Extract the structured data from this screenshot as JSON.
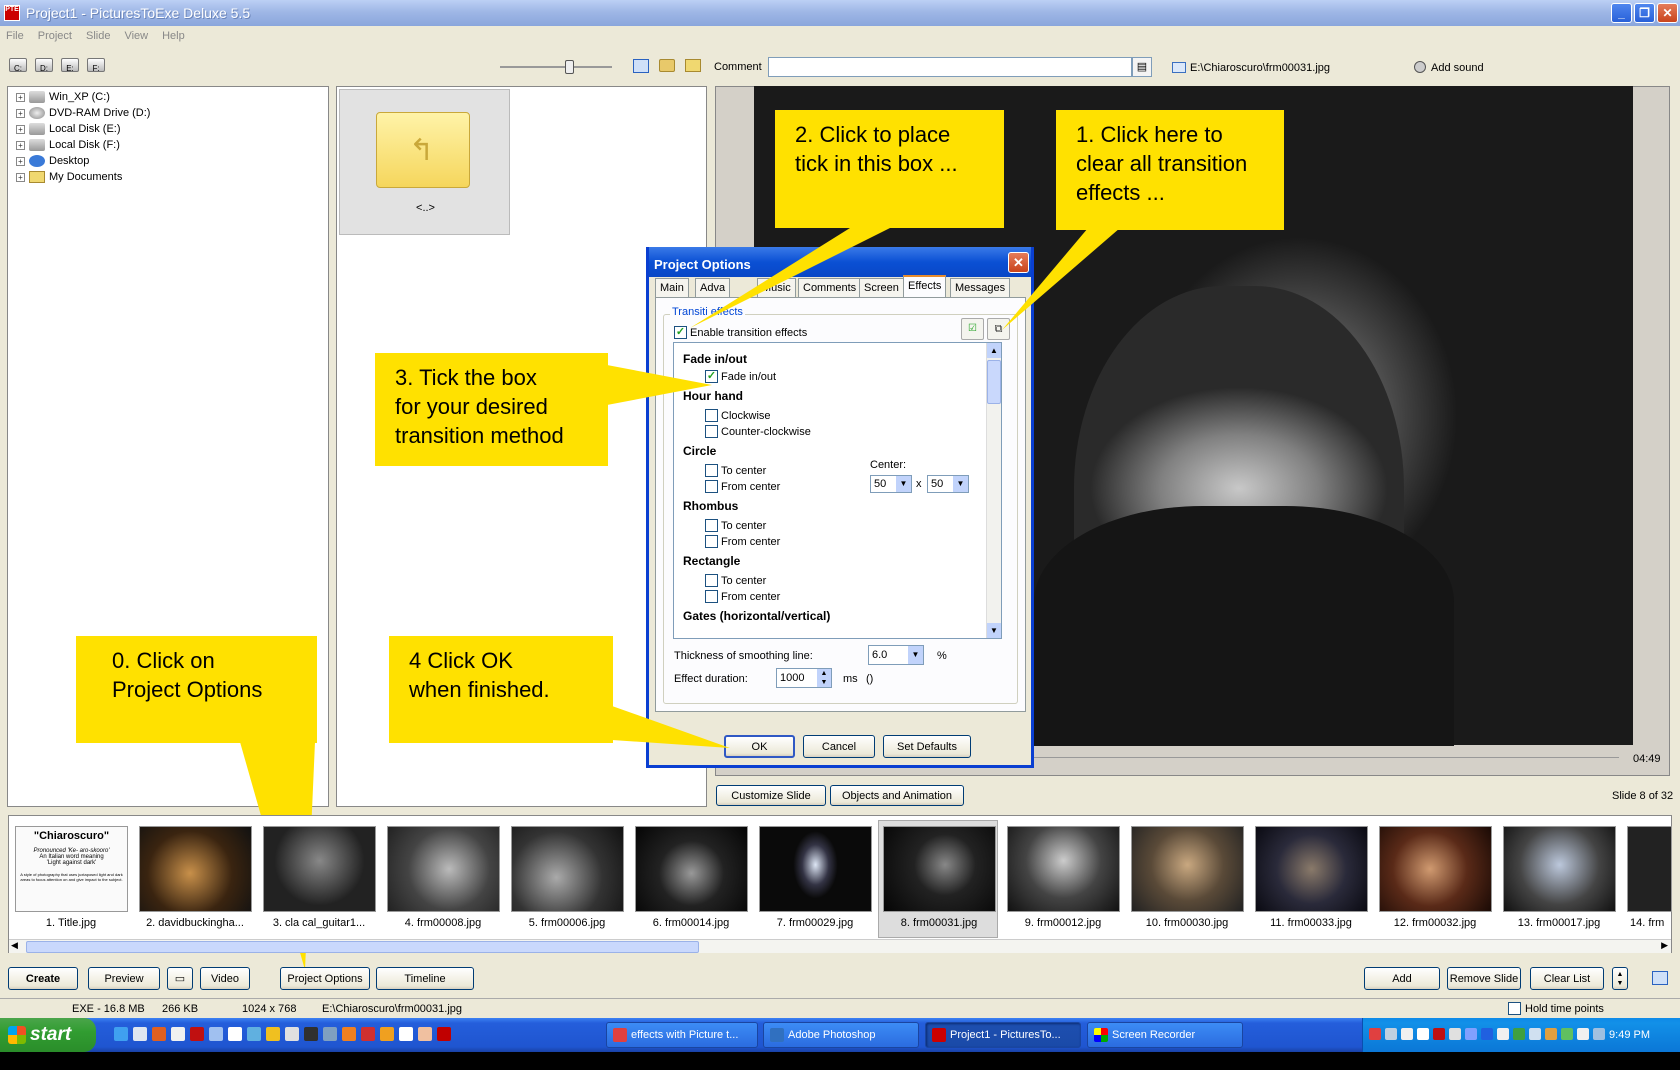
{
  "window": {
    "title": "Project1 - PicturesToExe Deluxe 5.5",
    "minimize": "_",
    "maximize": "❐",
    "close": "✕"
  },
  "menu": [
    "File",
    "Project",
    "Slide",
    "View",
    "Help"
  ],
  "drives_toolbar": [
    "C:",
    "D:",
    "E:",
    "F:"
  ],
  "comment": {
    "label": "Comment",
    "value": ""
  },
  "file_path": "E:\\Chiaroscuro\\frm00031.jpg",
  "add_sound": "Add sound",
  "tree": [
    {
      "label": "Win_XP (C:)"
    },
    {
      "label": "DVD-RAM Drive (D:)"
    },
    {
      "label": "Local Disk (E:)"
    },
    {
      "label": "Local Disk (F:)"
    },
    {
      "label": "Desktop"
    },
    {
      "label": "My Documents"
    }
  ],
  "folder_label": "<..>",
  "preview": {
    "time": "04:49",
    "slide_counter": "Slide 8 of 32"
  },
  "customize_slide": "Customize Slide",
  "objects_animation": "Objects and Animation",
  "dialog": {
    "title": "Project Options",
    "tabs": [
      "Main",
      "Adva",
      "Music",
      "Comments",
      "Screen",
      "Effects",
      "Messages"
    ],
    "active_tab": "Effects",
    "group_label": "Transiti  effects",
    "enable_label": "Enable transition effects",
    "groups": [
      {
        "name": "Fade in/out",
        "items": [
          {
            "label": "Fade in/out",
            "checked": true
          }
        ]
      },
      {
        "name": "Hour hand",
        "items": [
          {
            "label": "Clockwise",
            "checked": false
          },
          {
            "label": "Counter-clockwise",
            "checked": false
          }
        ]
      },
      {
        "name": "Circle",
        "items": [
          {
            "label": "To center",
            "checked": false
          },
          {
            "label": "From center",
            "checked": false
          }
        ]
      },
      {
        "name": "Rhombus",
        "items": [
          {
            "label": "To center",
            "checked": false
          },
          {
            "label": "From center",
            "checked": false
          }
        ]
      },
      {
        "name": "Rectangle",
        "items": [
          {
            "label": "To center",
            "checked": false
          },
          {
            "label": "From center",
            "checked": false
          }
        ]
      },
      {
        "name": "Gates (horizontal/vertical)",
        "items": []
      }
    ],
    "center_label": "Center:",
    "center_x": "50",
    "center_sep": "x",
    "center_y": "50",
    "thickness_label": "Thickness of smoothing line:",
    "thickness_value": "6.0",
    "thickness_unit": "%",
    "duration_label": "Effect duration:",
    "duration_value": "1000",
    "duration_unit": "ms",
    "duration_extra": "()",
    "ok": "OK",
    "cancel": "Cancel",
    "set_defaults": "Set Defaults"
  },
  "callouts": {
    "c0": "0.  Click on\nProject Options",
    "c1": "1.  Click here to\nclear all transition\neffects ...",
    "c2": "2.   Click to place\ntick in this box ...",
    "c3": "3.  Tick the box\nfor your desired\ntransition method",
    "c4": "4  Click OK\nwhen finished."
  },
  "title_slide": {
    "heading": "\"Chiaroscuro\"",
    "line1": "Pronounced 'Ke- aro-skooro'",
    "line2": "An Italian word meaning",
    "line3": "'Light against dark'",
    "body": "A style of photography that uses juxtaposed light and dark areas to focus attention on and give impact to the subject."
  },
  "thumbnails": [
    "1. Title.jpg",
    "2. davidbuckingha...",
    "3. cla    cal_guitar1...",
    "4. frm00008.jpg",
    "5. frm00006.jpg",
    "6. frm00014.jpg",
    "7. frm00029.jpg",
    "8. frm00031.jpg",
    "9. frm00012.jpg",
    "10. frm00030.jpg",
    "11. frm00033.jpg",
    "12. frm00032.jpg",
    "13. frm00017.jpg",
    "14. frm"
  ],
  "bottom_buttons": {
    "create": "Create",
    "preview": "Preview",
    "video": "Video",
    "project_options": "Project Options",
    "timeline": "Timeline",
    "add": "Add",
    "remove_slide": "Remove Slide",
    "clear_list": "Clear List"
  },
  "status": {
    "exe": "EXE - 16.8 MB",
    "size": "266 KB",
    "res": "1024 x 768",
    "path": "E:\\Chiaroscuro\\frm00031.jpg",
    "hold": "Hold time points"
  },
  "taskbar": {
    "start": "start",
    "buttons": [
      "effects with Picture t...",
      "Adobe Photoshop",
      "Project1 - PicturesTo...",
      "Screen Recorder"
    ],
    "clock": "9:49 PM"
  },
  "colors": {
    "callout": "#ffe100",
    "title_blue": "#0b50d4",
    "taskbar": "#245edb",
    "start_green": "#319d31"
  }
}
